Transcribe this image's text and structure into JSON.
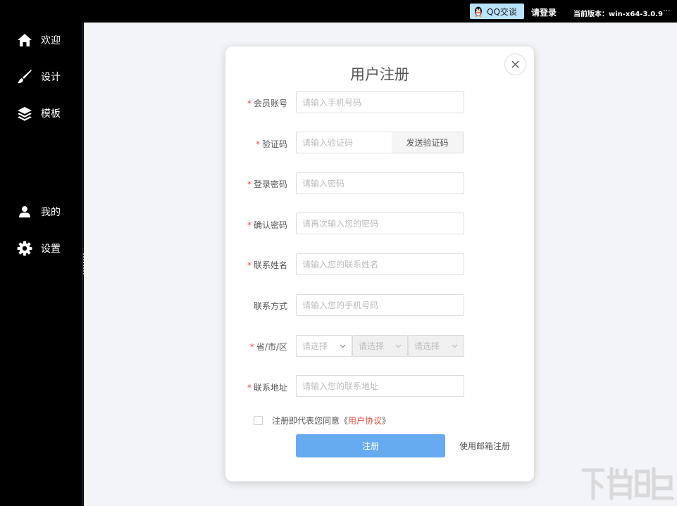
{
  "topbar": {
    "qq_label": "QQ交谈",
    "login_label": "请登录",
    "version_label": "当前版本：win-x64-3.0.9",
    "more_label": "···"
  },
  "sidebar": {
    "items": [
      {
        "label": "欢迎",
        "icon": "home-icon"
      },
      {
        "label": "设计",
        "icon": "brush-icon"
      },
      {
        "label": "模板",
        "icon": "layers-icon"
      },
      {
        "label": "我的",
        "icon": "user-icon"
      },
      {
        "label": "设置",
        "icon": "gear-icon"
      }
    ]
  },
  "modal": {
    "title": "用户注册",
    "close_icon": "close-icon",
    "fields": {
      "account": {
        "label": "会员账号",
        "placeholder": "请输入手机号码",
        "required": true
      },
      "code": {
        "label": "验证码",
        "placeholder": "请输入验证码",
        "required": true,
        "button": "发送验证码"
      },
      "password": {
        "label": "登录密码",
        "placeholder": "请输入密码",
        "required": true
      },
      "confirm": {
        "label": "确认密码",
        "placeholder": "请再次输入您的密码",
        "required": true
      },
      "contact_name": {
        "label": "联系姓名",
        "placeholder": "请输入您的联系姓名",
        "required": true
      },
      "contact_phone": {
        "label": "联系方式",
        "placeholder": "请输入您的手机号码",
        "required": false
      },
      "region": {
        "label": "省/市/区",
        "required": true,
        "province": "请选择",
        "city": "请选择",
        "district": "请选择"
      },
      "address": {
        "label": "联系地址",
        "placeholder": "请输入您的联系地址",
        "required": true
      }
    },
    "required_mark": "*",
    "agree_prefix": "注册即代表您同意《",
    "agree_link": "用户协议",
    "agree_suffix": "》",
    "submit_label": "注册",
    "email_register_label": "使用邮箱注册"
  },
  "colors": {
    "accent": "#66abf0",
    "required": "#e74c3c",
    "sidebar_bg": "#000000",
    "main_bg": "#f3f4f8"
  }
}
